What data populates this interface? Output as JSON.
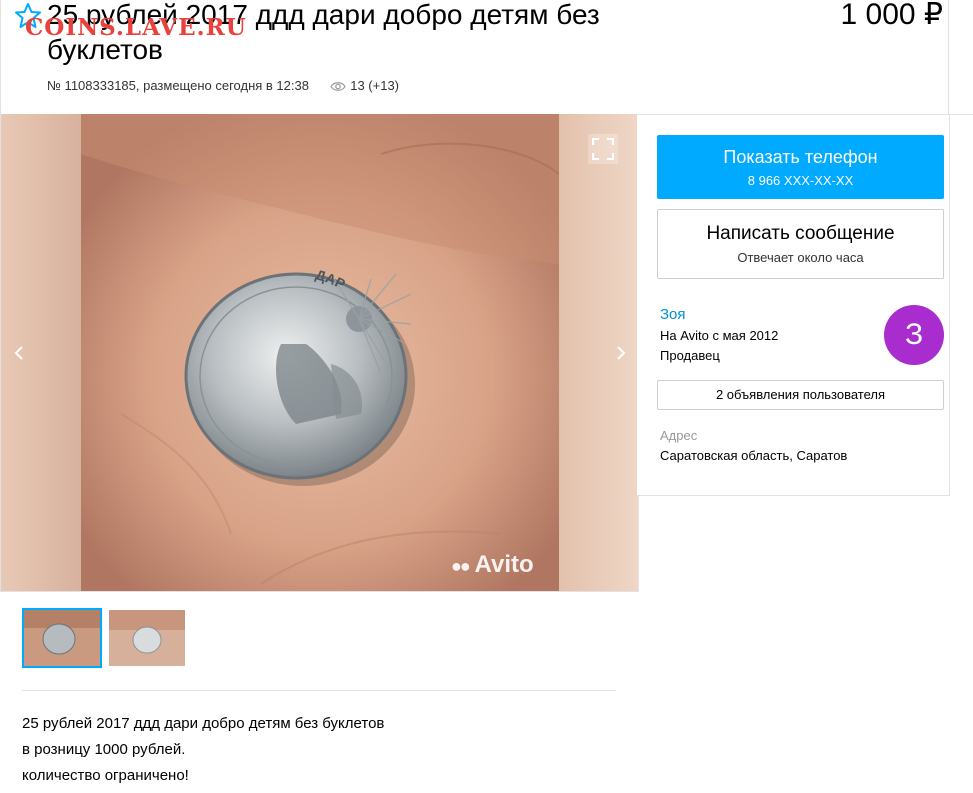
{
  "watermark": "COINS.LAVE.RU",
  "listing": {
    "title": "25 рублей 2017 ддд дари добро детям без буклетов",
    "price": "1 000 ₽",
    "meta_number": "№ 1108333185, размещено сегодня в 12:38",
    "views": "13 (+13)"
  },
  "gallery": {
    "avito_mark": "Avito"
  },
  "coin": {
    "inscription": "ДАРИ ДОБРО ДЕТЯМ"
  },
  "contact": {
    "show_phone_label": "Показать телефон",
    "phone_masked": "8 966 XXX-XX-XX",
    "message_label": "Написать сообщение",
    "message_sub": "Отвечает около часа"
  },
  "seller": {
    "name": "Зоя",
    "since": "На Avito с мая 2012",
    "role": "Продавец",
    "avatar_letter": "З",
    "avatar_color": "#a92ccf",
    "ads_button": "2 объявления пользователя",
    "address_label": "Адрес",
    "address_value": "Саратовская область, Саратов"
  },
  "description": {
    "lines": [
      "25 рублей 2017 ддд дари добро детям без буклетов",
      "в розницу 1000 рублей.",
      "количество ограничено!"
    ]
  },
  "colors": {
    "accent": "#00aaff",
    "link": "#0091d9",
    "watermark": "#e9413c"
  }
}
